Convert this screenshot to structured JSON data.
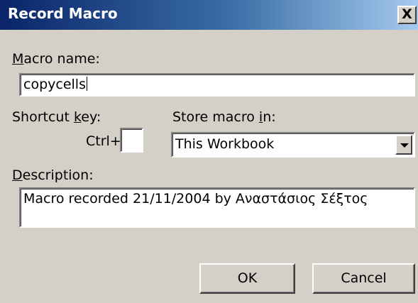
{
  "window": {
    "title": "Record Macro",
    "close_label": "X"
  },
  "macro_name": {
    "label_accel": "M",
    "label_rest": "acro name:",
    "value": "copycells"
  },
  "shortcut": {
    "label_pre": "Shortcut ",
    "label_accel": "k",
    "label_post": "ey:",
    "prefix": "Ctrl+",
    "value": ""
  },
  "store": {
    "label_pre": "Store macro ",
    "label_accel": "i",
    "label_post": "n:",
    "selected": "This Workbook"
  },
  "description": {
    "label_accel": "D",
    "label_rest": "escription:",
    "value": "Macro recorded 21/11/2004 by Αναστάσιος Σέξτος"
  },
  "buttons": {
    "ok": "OK",
    "cancel": "Cancel"
  }
}
